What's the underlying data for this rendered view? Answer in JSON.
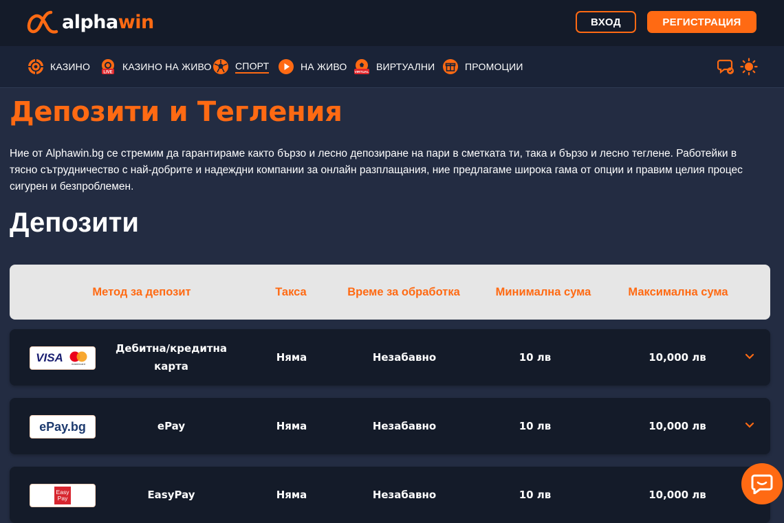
{
  "brand": {
    "logo_alpha": "alpha",
    "logo_win": "win",
    "accent": "#ff6a13"
  },
  "auth": {
    "login_label": "ВХОД",
    "register_label": "РЕГИСТРАЦИЯ"
  },
  "nav": {
    "items": [
      {
        "label": "КАЗИНО",
        "icon": "casino-chip-icon"
      },
      {
        "label": "КАЗИНО НА ЖИВО",
        "icon": "live-casino-icon",
        "badge": "LIVE"
      },
      {
        "label": "СПОРТ",
        "icon": "football-icon",
        "active": true
      },
      {
        "label": "НА ЖИВО",
        "icon": "play-icon"
      },
      {
        "label": "ВИРТУАЛНИ",
        "icon": "virtual-sports-icon",
        "badge": "VIRTUAL"
      },
      {
        "label": "ПРОМОЦИИ",
        "icon": "gift-icon"
      }
    ]
  },
  "page": {
    "title": "Депозити и Тегления",
    "intro": "Ние от Alphawin.bg се стремим да гарантираме както бързо и лесно депозиране на пари в сметката ти, така и бързо и лесно теглене. Работейки в тясно сътрудничество с най-добрите и надеждни компании за онлайн разплащания, ние предлагаме широка гама от опции и правим целия процес сигурен и безпроблемен.",
    "section_title": "Депозити"
  },
  "table": {
    "headers": {
      "method": "Метод за депозит",
      "fee": "Такса",
      "processing": "Време за обработка",
      "min": "Минимална сума",
      "max": "Максимална сума"
    },
    "rows": [
      {
        "logo": "visa-mastercard-logo",
        "logo_text": "VISA",
        "logo_sub": "mastercard",
        "method": "Дебитна/кредитна карта",
        "fee": "Няма",
        "processing": "Незабавно",
        "min": "10 лв",
        "max": "10,000 лв"
      },
      {
        "logo": "epay-logo",
        "logo_text": "ePay.bg",
        "method": "ePay",
        "fee": "Няма",
        "processing": "Незабавно",
        "min": "10 лв",
        "max": "10,000 лв"
      },
      {
        "logo": "easypay-logo",
        "logo_text": "Easy Pay",
        "method": "EasyPay",
        "fee": "Няма",
        "processing": "Незабавно",
        "min": "10 лв",
        "max": "10,000 лв"
      }
    ]
  }
}
